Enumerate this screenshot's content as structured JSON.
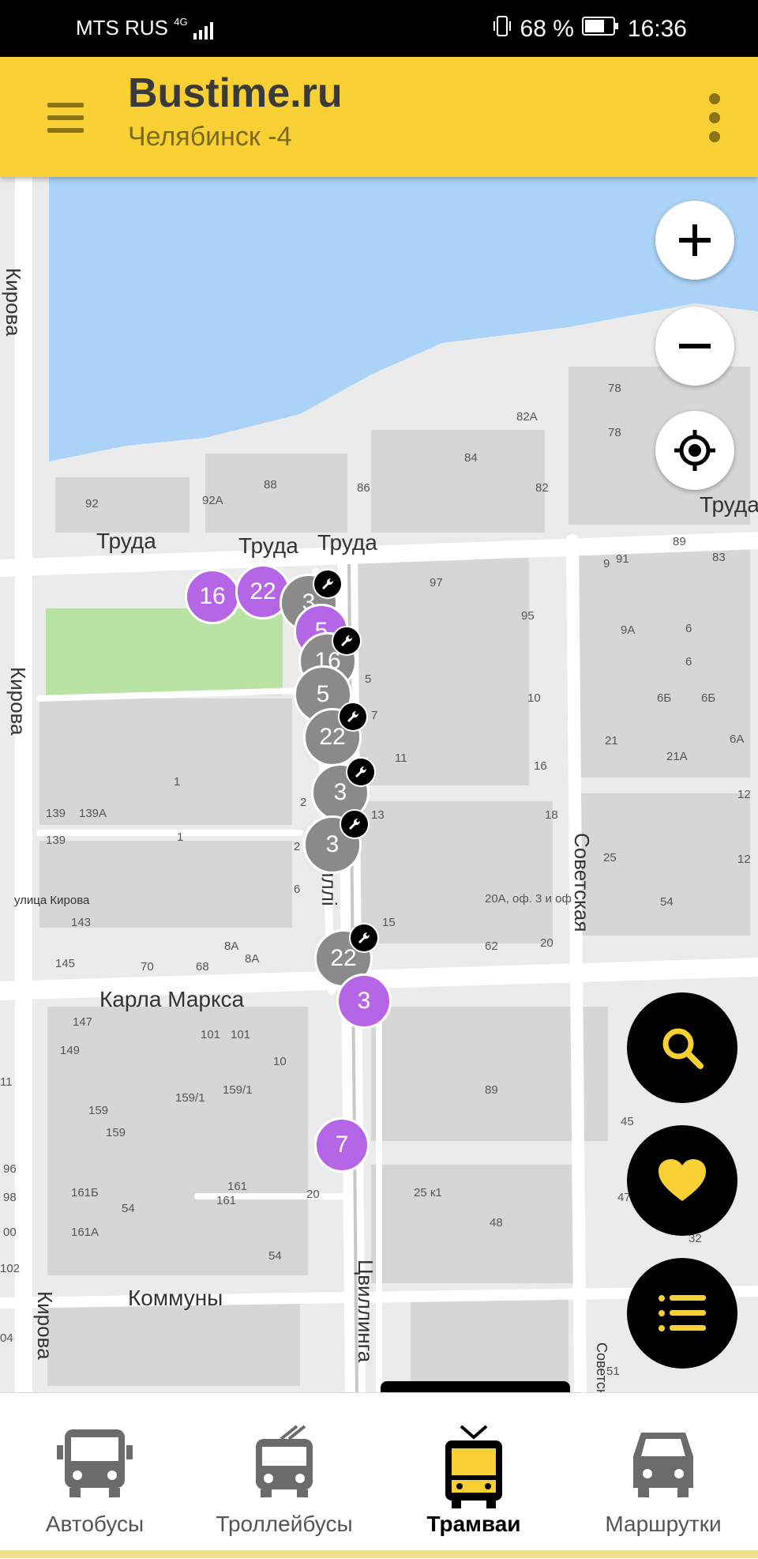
{
  "status": {
    "carrier": "MTS RUS",
    "network": "4G",
    "battery": "68 %",
    "time": "16:36"
  },
  "appbar": {
    "title": "Bustime.ru",
    "subtitle": "Челябинск -4"
  },
  "map": {
    "streets": {
      "kirova": "Кирова",
      "truda": "Труда",
      "karla_marksa": "Карла Маркса",
      "kommuny": "Коммуны",
      "sovetskaya": "Советская",
      "tsvillinga": "Цвиллинга",
      "ulitsa_kirova": "улица Кирова",
      "tsvil_fragment": "иллі"
    },
    "house_numbers": [
      "92",
      "92А",
      "88",
      "86",
      "84",
      "82",
      "82А",
      "78",
      "78",
      "97",
      "95",
      "9",
      "91",
      "89",
      "83",
      "9А",
      "6",
      "6",
      "6Б",
      "6Б",
      "6А",
      "21",
      "21А",
      "10",
      "16",
      "11",
      "13",
      "18",
      "12",
      "12",
      "25",
      "54",
      "20А, оф. 3 и оф",
      "15",
      "62",
      "20",
      "5",
      "7",
      "1",
      "1",
      "139",
      "139А",
      "139",
      "143",
      "145",
      "70",
      "68",
      "8А",
      "8А",
      "2",
      "2",
      "6",
      "147",
      "149",
      "101",
      "101",
      "10",
      "159",
      "159/1",
      "159/1",
      "159",
      "89",
      "45",
      "161Б",
      "161",
      "161",
      "54",
      "20",
      "25 к1",
      "48",
      "161А",
      "54",
      "96",
      "98",
      "00",
      "102",
      "04",
      "47",
      "32",
      "51",
      "11"
    ],
    "vehicles": [
      {
        "route": "16",
        "type": "tram",
        "state": "active"
      },
      {
        "route": "22",
        "type": "tram",
        "state": "active"
      },
      {
        "route": "3",
        "type": "tram",
        "state": "repair"
      },
      {
        "route": "5",
        "type": "tram",
        "state": "active"
      },
      {
        "route": "16",
        "type": "tram",
        "state": "repair"
      },
      {
        "route": "5",
        "type": "tram",
        "state": "repair"
      },
      {
        "route": "22",
        "type": "tram",
        "state": "repair"
      },
      {
        "route": "3",
        "type": "tram",
        "state": "repair"
      },
      {
        "route": "3",
        "type": "tram",
        "state": "repair"
      },
      {
        "route": "22",
        "type": "tram",
        "state": "repair"
      },
      {
        "route": "3",
        "type": "tram",
        "state": "active"
      },
      {
        "route": "7",
        "type": "tram",
        "state": "active"
      }
    ],
    "controls": {
      "zoom_in": "plus-icon",
      "zoom_out": "minus-icon",
      "locate": "crosshair-icon"
    },
    "fabs": {
      "search": "search-icon",
      "favorites": "heart-icon",
      "list": "list-icon"
    }
  },
  "colors": {
    "accent": "#f8d033",
    "tram_active": "#b466e6",
    "tram_repair": "#8a8a8a",
    "water": "#aad3f7",
    "park": "#b9e3a4"
  },
  "bottom_nav": {
    "items": [
      {
        "label": "Автобусы",
        "icon": "bus-icon",
        "active": false
      },
      {
        "label": "Троллейбусы",
        "icon": "trolleybus-icon",
        "active": false
      },
      {
        "label": "Трамваи",
        "icon": "tram-icon",
        "active": true
      },
      {
        "label": "Маршрутки",
        "icon": "minibus-icon",
        "active": false
      }
    ]
  }
}
